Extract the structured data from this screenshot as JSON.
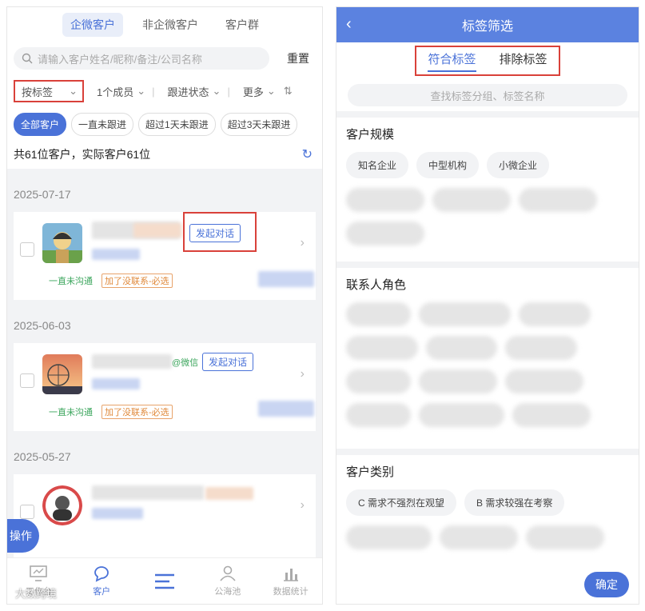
{
  "left": {
    "tabs": [
      "企微客户",
      "非企微客户",
      "客户群"
    ],
    "search": {
      "placeholder": "请输入客户姓名/昵称/备注/公司名称",
      "reset": "重置"
    },
    "filters": {
      "by_tag": "按标签",
      "members": "1个成员",
      "follow_status": "跟进状态",
      "more": "更多"
    },
    "chips": [
      "全部客户",
      "一直未跟进",
      "超过1天未跟进",
      "超过3天未跟进"
    ],
    "summary": "共61位客户，实际客户61位",
    "groups": [
      {
        "date": "2025-07-17",
        "chat_button": "发起对话",
        "status": "一直未沟通",
        "tag": "加了没联系-必选"
      },
      {
        "date": "2025-06-03",
        "chat_button": "发起对话",
        "wechat_suffix": "@微信",
        "status": "一直未沟通",
        "tag": "加了没联系-必选"
      },
      {
        "date": "2025-05-27"
      }
    ],
    "op_button": "操作",
    "nav": [
      "工作台",
      "客户",
      "",
      "公海池",
      "数据统计"
    ],
    "watermark": "大数跨境"
  },
  "right": {
    "title": "标签筛选",
    "tabs": [
      "符合标签",
      "排除标签"
    ],
    "search_placeholder": "查找标签分组、标签名称",
    "groups": [
      {
        "title": "客户规模",
        "tags": [
          "知名企业",
          "中型机构",
          "小微企业"
        ]
      },
      {
        "title": "联系人角色"
      },
      {
        "title": "客户类别",
        "tags": [
          "C 需求不强烈在观望",
          "B 需求较强在考察"
        ]
      }
    ],
    "confirm": "确定"
  },
  "colors": {
    "accent": "#4a72d8",
    "highlight": "#d9413a",
    "header": "#5b82e0"
  }
}
